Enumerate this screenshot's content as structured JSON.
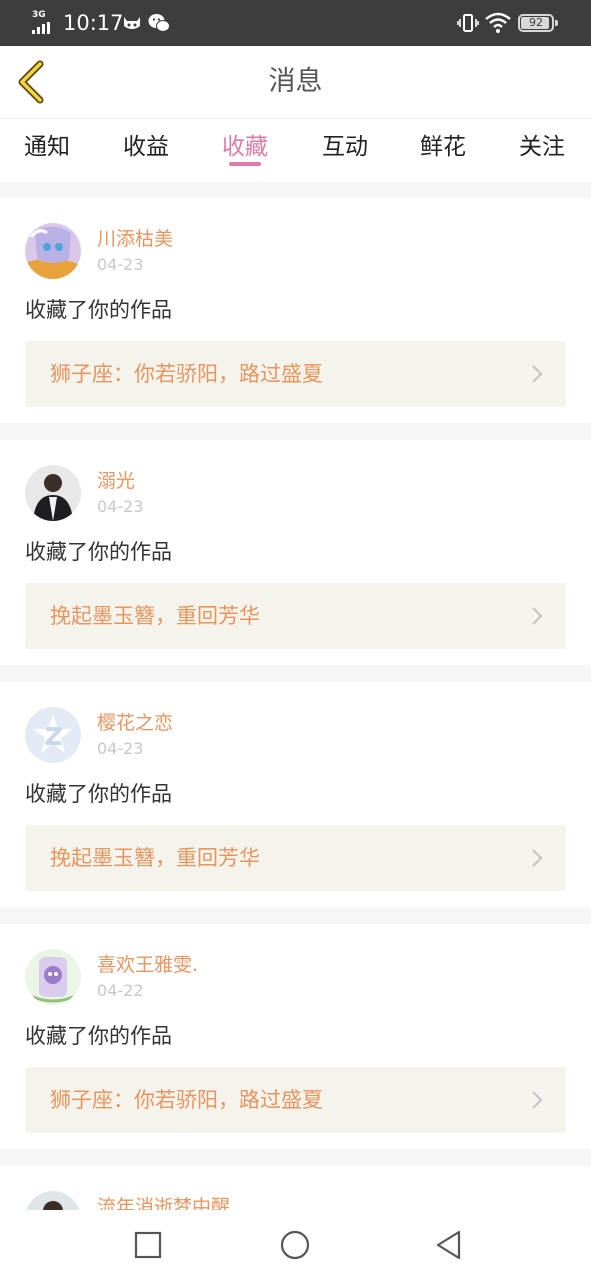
{
  "status_bar": {
    "network": "3G",
    "time": "10:17",
    "battery": "92",
    "icons": [
      "signal-icon",
      "cat-notification-icon",
      "wechat-icon",
      "vibrate-icon",
      "wifi-icon",
      "battery-icon"
    ]
  },
  "header": {
    "title": "消息",
    "back_icon": "back-chevron-icon"
  },
  "tabs": [
    {
      "label": "通知"
    },
    {
      "label": "收益"
    },
    {
      "label": "收藏",
      "active": true
    },
    {
      "label": "互动"
    },
    {
      "label": "鲜花"
    },
    {
      "label": "关注"
    }
  ],
  "colors": {
    "accent": "#e07aa8",
    "name": "#e8955f",
    "workbox_bg": "#f4f4ec",
    "status_bar": "#3d3d3d"
  },
  "items": [
    {
      "name": "川添枯美",
      "date": "04-23",
      "action": "收藏了你的作品",
      "work": "狮子座：你若骄阳，路过盛夏"
    },
    {
      "name": "溺光",
      "date": "04-23",
      "action": "收藏了你的作品",
      "work": "挽起墨玉簪，重回芳华"
    },
    {
      "name": "樱花之恋",
      "date": "04-23",
      "action": "收藏了你的作品",
      "work": "挽起墨玉簪，重回芳华"
    },
    {
      "name": "喜欢王雅雯.",
      "date": "04-22",
      "action": "收藏了你的作品",
      "work": "狮子座：你若骄阳，路过盛夏"
    },
    {
      "name": "流年消逝梦中醒"
    }
  ],
  "nav": [
    "recent-apps-icon",
    "home-icon",
    "back-triangle-icon"
  ]
}
